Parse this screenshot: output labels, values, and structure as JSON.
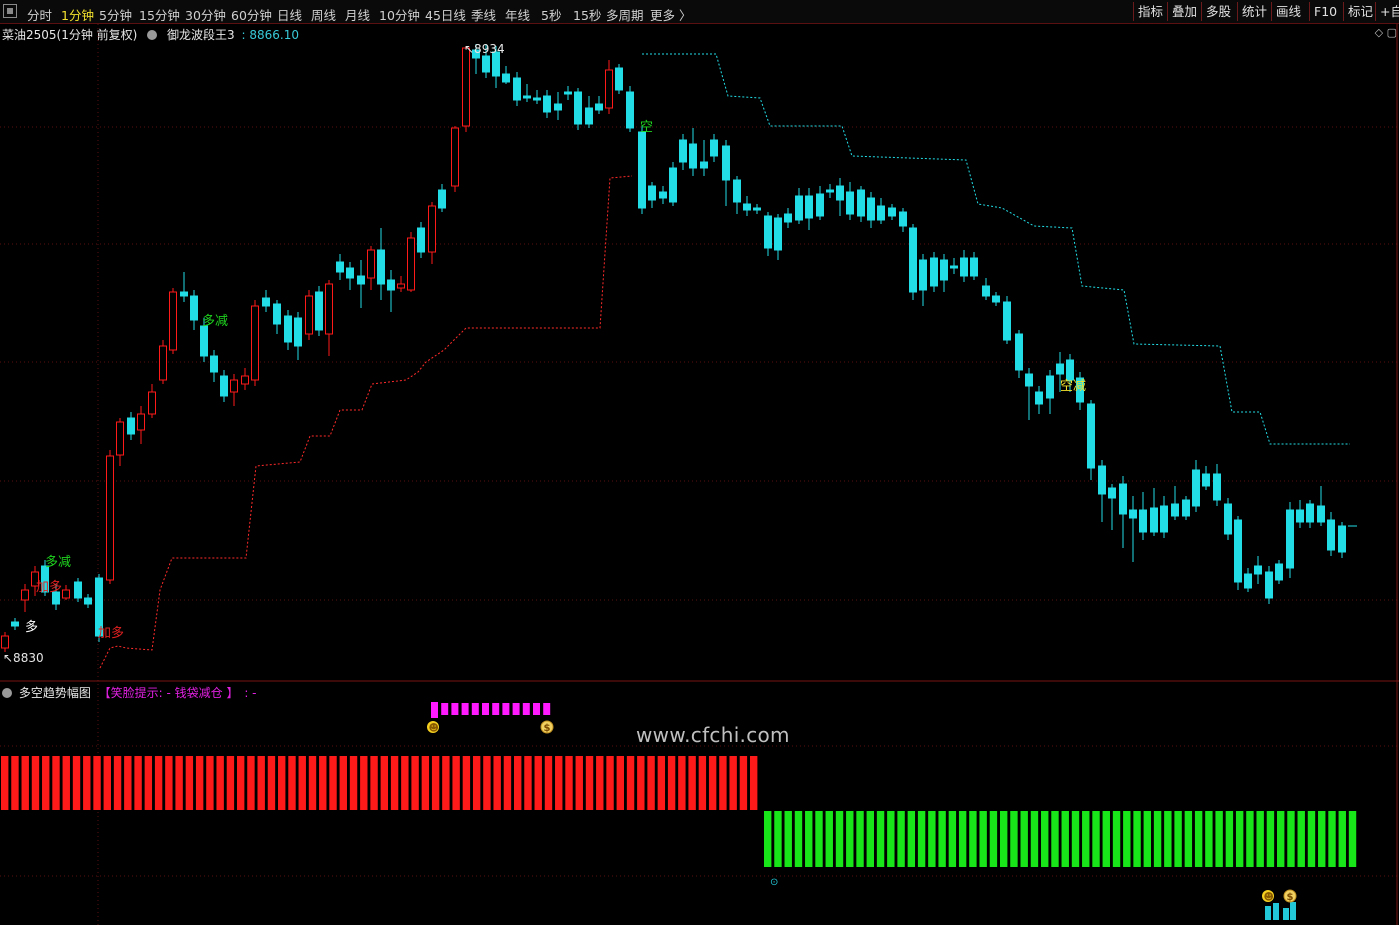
{
  "toolbar": {
    "periods": [
      "分时",
      "1分钟",
      "5分钟",
      "15分钟",
      "30分钟",
      "60分钟",
      "日线",
      "周线",
      "月线",
      "10分钟",
      "45日线",
      "季线",
      "年线",
      "5秒",
      "15秒",
      "多周期",
      "更多 〉"
    ],
    "active_period": "1分钟",
    "tools": [
      "指标",
      "叠加",
      "多股",
      "统计",
      "画线",
      "F10",
      "标记",
      "+自"
    ]
  },
  "info": {
    "symbol": "菜油2505(1分钟 前复权)",
    "indicator": "御龙波段王3",
    "value": ": 8866.10",
    "right_icons": "◇  ▢"
  },
  "main_chart": {
    "high_label": "8934",
    "low_label": "8830",
    "signals": [
      {
        "text": "多减",
        "color": "#1ed31e"
      },
      {
        "text": "加多",
        "color": "#e02020"
      },
      {
        "text": "多",
        "color": "#ffffff"
      },
      {
        "text": "加多",
        "color": "#e02020"
      },
      {
        "text": "多减",
        "color": "#1ed31e"
      },
      {
        "text": "空",
        "color": "#1ed31e"
      },
      {
        "text": "空减",
        "color": "#f2e12e"
      }
    ],
    "colors": {
      "up": "#ff1a1a",
      "down": "#22dde6",
      "support": "#ff2a2a",
      "resistance": "#22dde6"
    }
  },
  "sub_chart": {
    "name": "多空趋势幅图",
    "tip": "【笑脸提示: - 钱袋减仓 】",
    "tail": ": -",
    "smile_icon": "☻",
    "bag_icon": "$",
    "marker_text": "⊙",
    "colors": {
      "bull": "#ff1a1a",
      "bear": "#19e619",
      "hint": "#ff1aff",
      "small": "#22c8d8"
    }
  },
  "watermark": "www.cfchi.com"
}
